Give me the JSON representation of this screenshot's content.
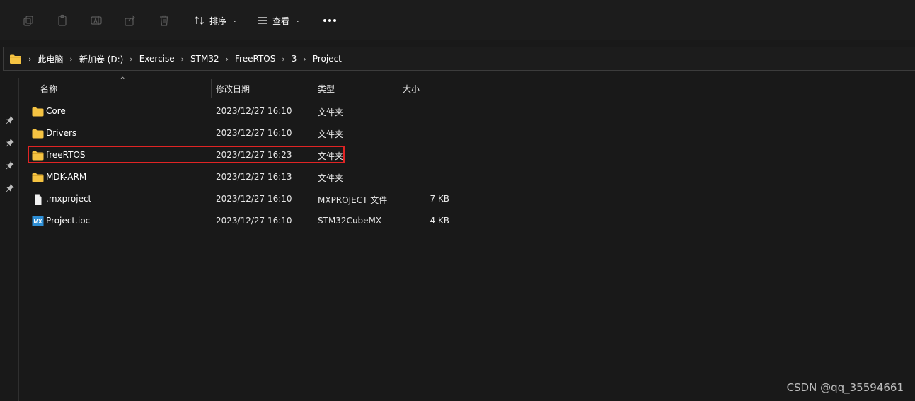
{
  "toolbar": {
    "sort_label": "排序",
    "view_label": "查看",
    "icons": [
      "copy-icon",
      "paste-icon",
      "rename-icon",
      "share-icon",
      "delete-icon",
      "sort-icon",
      "view-icon",
      "more-icon"
    ]
  },
  "address_bar": {
    "crumbs": [
      "此电脑",
      "新加卷 (D:)",
      "Exercise",
      "STM32",
      "FreeRTOS",
      "3",
      "Project"
    ]
  },
  "columns": {
    "name": "名称",
    "modified": "修改日期",
    "type": "类型",
    "size": "大小"
  },
  "files": [
    {
      "name": "Core",
      "modified": "2023/12/27 16:10",
      "type": "文件夹",
      "size": "",
      "icon": "folder-icon"
    },
    {
      "name": "Drivers",
      "modified": "2023/12/27 16:10",
      "type": "文件夹",
      "size": "",
      "icon": "folder-icon"
    },
    {
      "name": "freeRTOS",
      "modified": "2023/12/27 16:23",
      "type": "文件夹",
      "size": "",
      "icon": "folder-icon"
    },
    {
      "name": "MDK-ARM",
      "modified": "2023/12/27 16:13",
      "type": "文件夹",
      "size": "",
      "icon": "folder-icon"
    },
    {
      "name": ".mxproject",
      "modified": "2023/12/27 16:10",
      "type": "MXPROJECT 文件",
      "size": "7 KB",
      "icon": "file-icon"
    },
    {
      "name": "Project.ioc",
      "modified": "2023/12/27 16:10",
      "type": "STM32CubeMX",
      "size": "4 KB",
      "icon": "mx-file-icon"
    }
  ],
  "mx_icon_text": "MX",
  "watermark": "CSDN @qq_35594661",
  "colors": {
    "background": "#191919",
    "folder": "#f5c342",
    "highlight": "#e02424",
    "mx_icon": "#2e8fd6"
  }
}
